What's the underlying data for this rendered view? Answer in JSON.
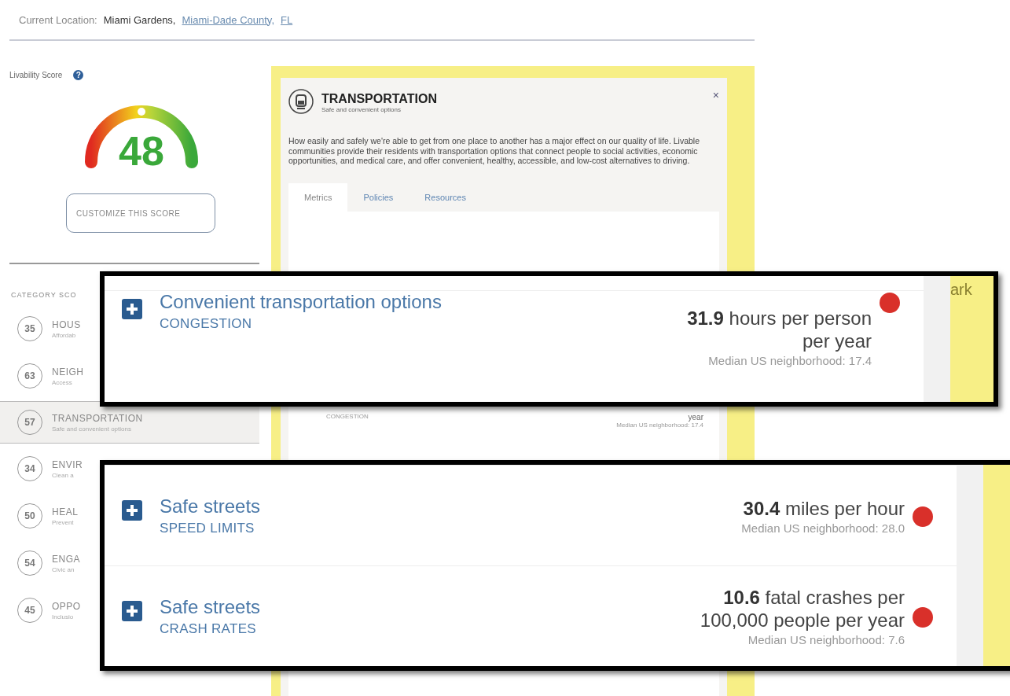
{
  "location": {
    "label": "Current Location:",
    "city": "Miami Gardens,",
    "county": "Miami-Dade County,",
    "state": "FL"
  },
  "score": {
    "label": "Livability Score",
    "help_glyph": "?",
    "value": "48",
    "customize_button": "CUSTOMIZE THIS SCORE"
  },
  "categories": {
    "heading": "CATEGORY SCO",
    "items": [
      {
        "score": "35",
        "title": "HOUS",
        "subtitle": "Affordab",
        "selected": false
      },
      {
        "score": "63",
        "title": "NEIGH",
        "subtitle": "Access",
        "selected": false
      },
      {
        "score": "57",
        "title": "TRANSPORTATION",
        "subtitle": "Safe and convenient options",
        "selected": true
      },
      {
        "score": "34",
        "title": "ENVIR",
        "subtitle": "Clean a",
        "selected": false
      },
      {
        "score": "50",
        "title": "HEAL",
        "subtitle": "Prevent",
        "selected": false
      },
      {
        "score": "54",
        "title": "ENGA",
        "subtitle": "Civic an",
        "selected": false
      },
      {
        "score": "45",
        "title": "OPPO",
        "subtitle": "Inclusio",
        "selected": false
      }
    ]
  },
  "panel": {
    "title": "TRANSPORTATION",
    "subtitle": "Safe and convenient options",
    "close": "×",
    "description": "How easily and safely we're able to get from one place to another has a major effect on our quality of life. Livable communities provide their residents with transportation options that connect people to social activities, economic opportunities, and medical care, and offer convenient, healthy, accessible, and low-cost alternatives to driving.",
    "tabs": [
      {
        "label": "Metrics",
        "selected": true
      },
      {
        "label": "Policies",
        "selected": false
      },
      {
        "label": "Resources",
        "selected": false
      }
    ],
    "partial_row": {
      "category": "CONGESTION",
      "value": "year",
      "median": "Median US neighborhood: 17.4"
    }
  },
  "callouts": [
    {
      "map_label": "ark",
      "metrics": [
        {
          "name": "Convenient transportation options",
          "category": "CONGESTION",
          "value": "**31.9** hours per person per year",
          "median": "Median US neighborhood: 17.4",
          "color": "#d9302a"
        }
      ]
    },
    {
      "metrics": [
        {
          "name": "Safe streets",
          "category": "SPEED LIMITS",
          "value": "**30.4** miles per hour",
          "median": "Median US neighborhood: 28.0",
          "color": "#d9302a"
        },
        {
          "name": "Safe streets",
          "category": "CRASH RATES",
          "value": "**10.6** fatal crashes per 100,000 people per year",
          "median": "Median US neighborhood: 7.6",
          "color": "#d9302a"
        }
      ]
    }
  ]
}
